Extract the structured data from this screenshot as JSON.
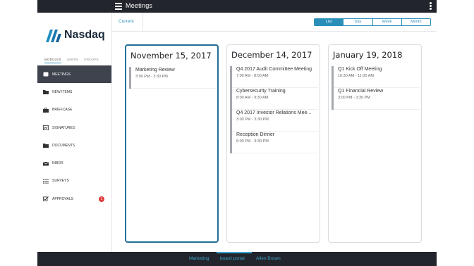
{
  "topbar": {
    "title": "Meetings"
  },
  "sidebar": {
    "logo_text": "Nasdaq",
    "subtabs": [
      "MODULES",
      "USERS",
      "GROUPS"
    ],
    "items": [
      {
        "label": "MEETINGS",
        "icon": "meetings-icon"
      },
      {
        "label": "NEW ITEMS",
        "icon": "folder-icon"
      },
      {
        "label": "BRIEFCASE",
        "icon": "briefcase-icon"
      },
      {
        "label": "SIGNATURES",
        "icon": "signature-icon"
      },
      {
        "label": "DOCUMENTS",
        "icon": "folder-icon"
      },
      {
        "label": "INBOX",
        "icon": "envelope-icon"
      },
      {
        "label": "SURVEYS",
        "icon": "list-icon"
      },
      {
        "label": "APPROVALS",
        "icon": "checkbox-icon",
        "badge": "1"
      }
    ]
  },
  "header": {
    "current_label": "Current",
    "views": [
      "List",
      "Day",
      "Week",
      "Month"
    ],
    "active_view": "List"
  },
  "columns": [
    {
      "date": "November 15, 2017",
      "events": [
        {
          "title": "Marketing Review",
          "time": "3:00 PM - 3:30 PM"
        }
      ]
    },
    {
      "date": "December 14, 2017",
      "events": [
        {
          "title": "Q4 2017 Audit Committee Meeting",
          "time": "7:00 AM - 8:00 AM"
        },
        {
          "title": "Cybersecurity Training",
          "time": "8:00 AM - 9:30 AM"
        },
        {
          "title": "Q4 2017 Investor Relations Mee...",
          "time": "3:00 PM - 3:30 PM"
        },
        {
          "title": "Reception Dinner",
          "time": "6:00 PM - 9:30 PM"
        }
      ]
    },
    {
      "date": "January 19, 2018",
      "events": [
        {
          "title": "Q1 Kick Off Meeting",
          "time": "10:30 AM - 11:00 AM"
        },
        {
          "title": "Q1 Financial Review",
          "time": "3:00 PM - 3:30 PM"
        }
      ]
    }
  ],
  "footer": {
    "links": [
      "Marketing",
      "board portal",
      "Allen Brown"
    ],
    "active": "board portal"
  },
  "colors": {
    "accent": "#2a8fb8",
    "dark": "#23252c",
    "sidebar_active": "#3e434d",
    "badge": "#e03c3c"
  }
}
